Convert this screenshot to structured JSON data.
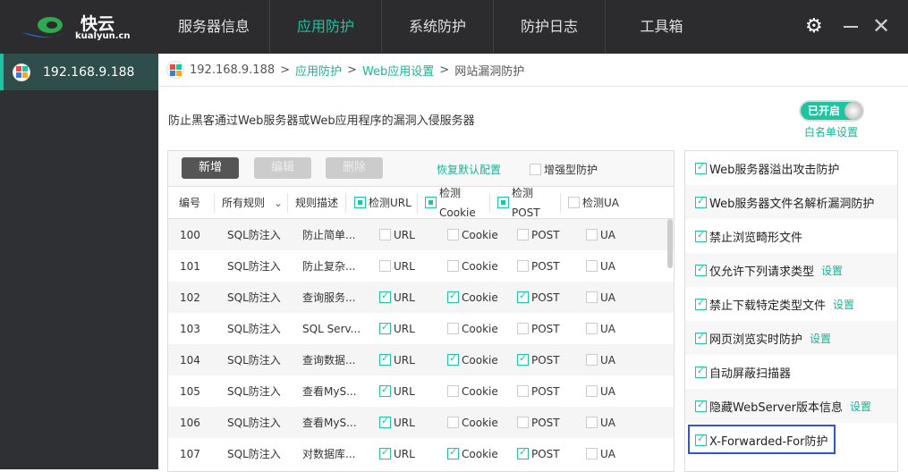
{
  "app": {
    "logo_name": "快云",
    "logo_domain": "kualyun.cn"
  },
  "nav": {
    "tabs": [
      {
        "label": "服务器信息",
        "active": false
      },
      {
        "label": "应用防护",
        "active": true
      },
      {
        "label": "系统防护",
        "active": false
      },
      {
        "label": "防护日志",
        "active": false
      },
      {
        "label": "工具箱",
        "active": false
      }
    ]
  },
  "sidebar": {
    "items": [
      {
        "label": "192.168.9.188",
        "selected": true
      }
    ]
  },
  "breadcrumb": {
    "host": "192.168.9.188",
    "sep": ">",
    "l1": "应用防护",
    "l2": "Web应用设置",
    "current": "网站漏洞防护"
  },
  "description": "防止黑客通过Web服务器或Web应用程序的漏洞入侵服务器",
  "toggle": {
    "label": "已开启",
    "on": true
  },
  "whitelist_link": "白名单设置",
  "toolbar": {
    "add": "新增",
    "edit": "编辑",
    "delete": "删除",
    "restore": "恢复默认配置",
    "enhanced": "增强型防护",
    "enhanced_checked": false
  },
  "table": {
    "headers": {
      "id": "编号",
      "filter": "所有规则",
      "desc": "规则描述",
      "url": "检测URL",
      "cookie": "检测Cookie",
      "post": "检测POST",
      "ua": "检测UA"
    },
    "header_checks": {
      "url": "partial",
      "cookie": "partial",
      "post": "partial",
      "ua": "none"
    },
    "labels": {
      "url": "URL",
      "cookie": "Cookie",
      "post": "POST",
      "ua": "UA"
    },
    "rows": [
      {
        "id": "100",
        "type": "SQL防注入",
        "desc": "防止简单...",
        "url": false,
        "cookie": false,
        "post": false,
        "ua": false
      },
      {
        "id": "101",
        "type": "SQL防注入",
        "desc": "防止复杂...",
        "url": false,
        "cookie": false,
        "post": false,
        "ua": false
      },
      {
        "id": "102",
        "type": "SQL防注入",
        "desc": "查询服务...",
        "url": true,
        "cookie": true,
        "post": true,
        "ua": false
      },
      {
        "id": "103",
        "type": "SQL防注入",
        "desc": "SQL Serv...",
        "url": true,
        "cookie": false,
        "post": false,
        "ua": false
      },
      {
        "id": "104",
        "type": "SQL防注入",
        "desc": "查询数据...",
        "url": true,
        "cookie": true,
        "post": true,
        "ua": false
      },
      {
        "id": "105",
        "type": "SQL防注入",
        "desc": "查看MyS...",
        "url": true,
        "cookie": false,
        "post": false,
        "ua": false
      },
      {
        "id": "106",
        "type": "SQL防注入",
        "desc": "查看MyS...",
        "url": true,
        "cookie": false,
        "post": false,
        "ua": false
      },
      {
        "id": "107",
        "type": "SQL防注入",
        "desc": "对数据库...",
        "url": true,
        "cookie": true,
        "post": true,
        "ua": false
      }
    ]
  },
  "options": [
    {
      "label": "Web服务器溢出攻击防护",
      "checked": true,
      "setting": ""
    },
    {
      "label": "Web服务器文件名解析漏洞防护",
      "checked": true,
      "setting": ""
    },
    {
      "label": "禁止浏览畸形文件",
      "checked": true,
      "setting": ""
    },
    {
      "label": "仅允许下列请求类型",
      "checked": true,
      "setting": "设置"
    },
    {
      "label": "禁止下载特定类型文件",
      "checked": true,
      "setting": "设置"
    },
    {
      "label": "网页浏览实时防护",
      "checked": true,
      "setting": "设置"
    },
    {
      "label": "自动屏蔽扫描器",
      "checked": true,
      "setting": ""
    },
    {
      "label": "隐藏WebServer版本信息",
      "checked": true,
      "setting": "设置"
    },
    {
      "label": "X-Forwarded-For防护",
      "checked": true,
      "setting": ""
    }
  ],
  "colors": {
    "accent": "#1ec3a0",
    "topbar": "#2c2c2f",
    "highlight_box": "#3355cc"
  }
}
